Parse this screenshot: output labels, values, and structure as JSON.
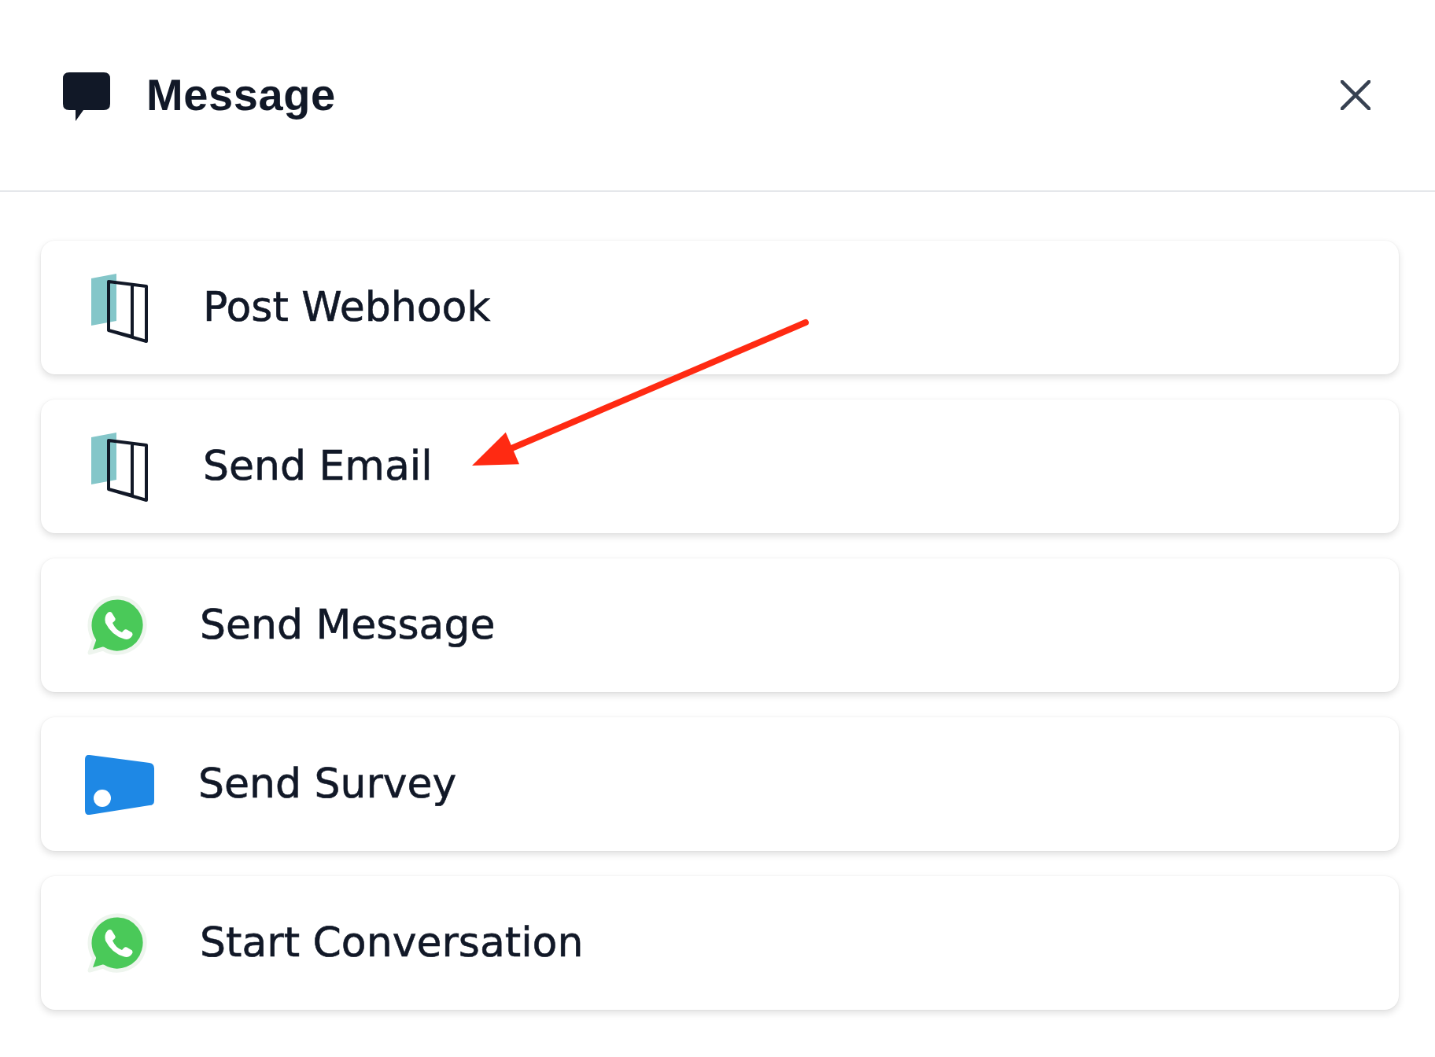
{
  "header": {
    "title": "Message"
  },
  "actions": [
    {
      "label": "Post Webhook",
      "kind": "book",
      "arrow_pointer": false
    },
    {
      "label": "Send Email",
      "kind": "book",
      "arrow_pointer": true
    },
    {
      "label": "Send Message",
      "kind": "chat",
      "arrow_pointer": false
    },
    {
      "label": "Send Survey",
      "kind": "card",
      "arrow_pointer": false
    },
    {
      "label": "Start Conversation",
      "kind": "chat",
      "arrow_pointer": false
    }
  ]
}
